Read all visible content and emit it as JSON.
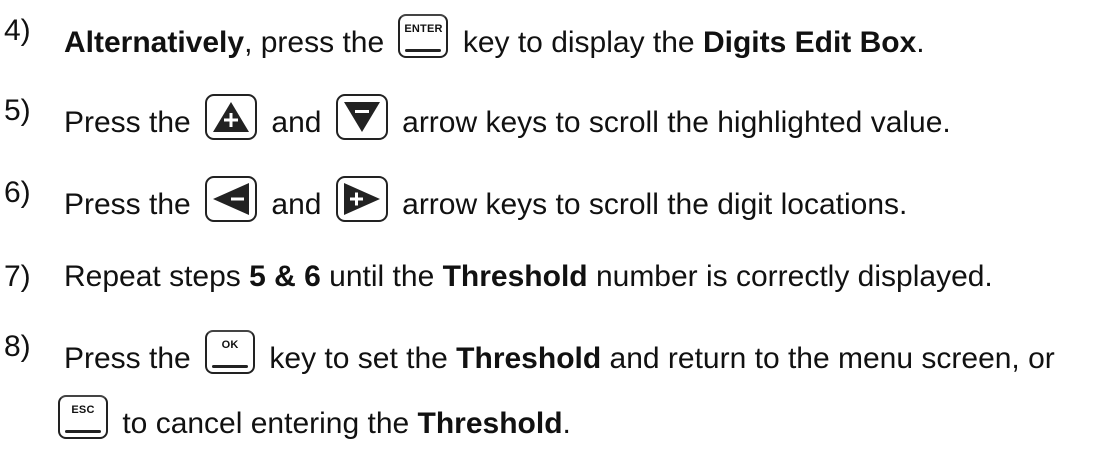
{
  "steps": [
    {
      "num": "4)",
      "parts": [
        "Alternatively",
        ", press the ",
        " key to display the ",
        "Digits Edit Box",
        "."
      ],
      "key_label": "ENTER"
    },
    {
      "num": "5)",
      "parts": [
        "Press the ",
        " and ",
        " arrow keys to scroll the highlighted value."
      ],
      "icons": [
        "up-arrow-key-icon",
        "down-arrow-key-icon"
      ]
    },
    {
      "num": "6)",
      "parts": [
        "Press the ",
        " and ",
        " arrow keys to scroll the digit locations."
      ],
      "icons": [
        "left-arrow-key-icon",
        "right-arrow-key-icon"
      ]
    },
    {
      "num": "7)",
      "parts": [
        "Repeat steps ",
        "5 & 6",
        " until the ",
        "Threshold",
        " number is correctly displayed."
      ]
    },
    {
      "num": "8)",
      "parts": [
        "Press the ",
        " key to set the ",
        "Threshold",
        " and return to the menu screen, or"
      ],
      "key_label": "OK",
      "line2": [
        " to cancel entering the ",
        "Threshold",
        "."
      ],
      "key2_label": "ESC"
    }
  ]
}
